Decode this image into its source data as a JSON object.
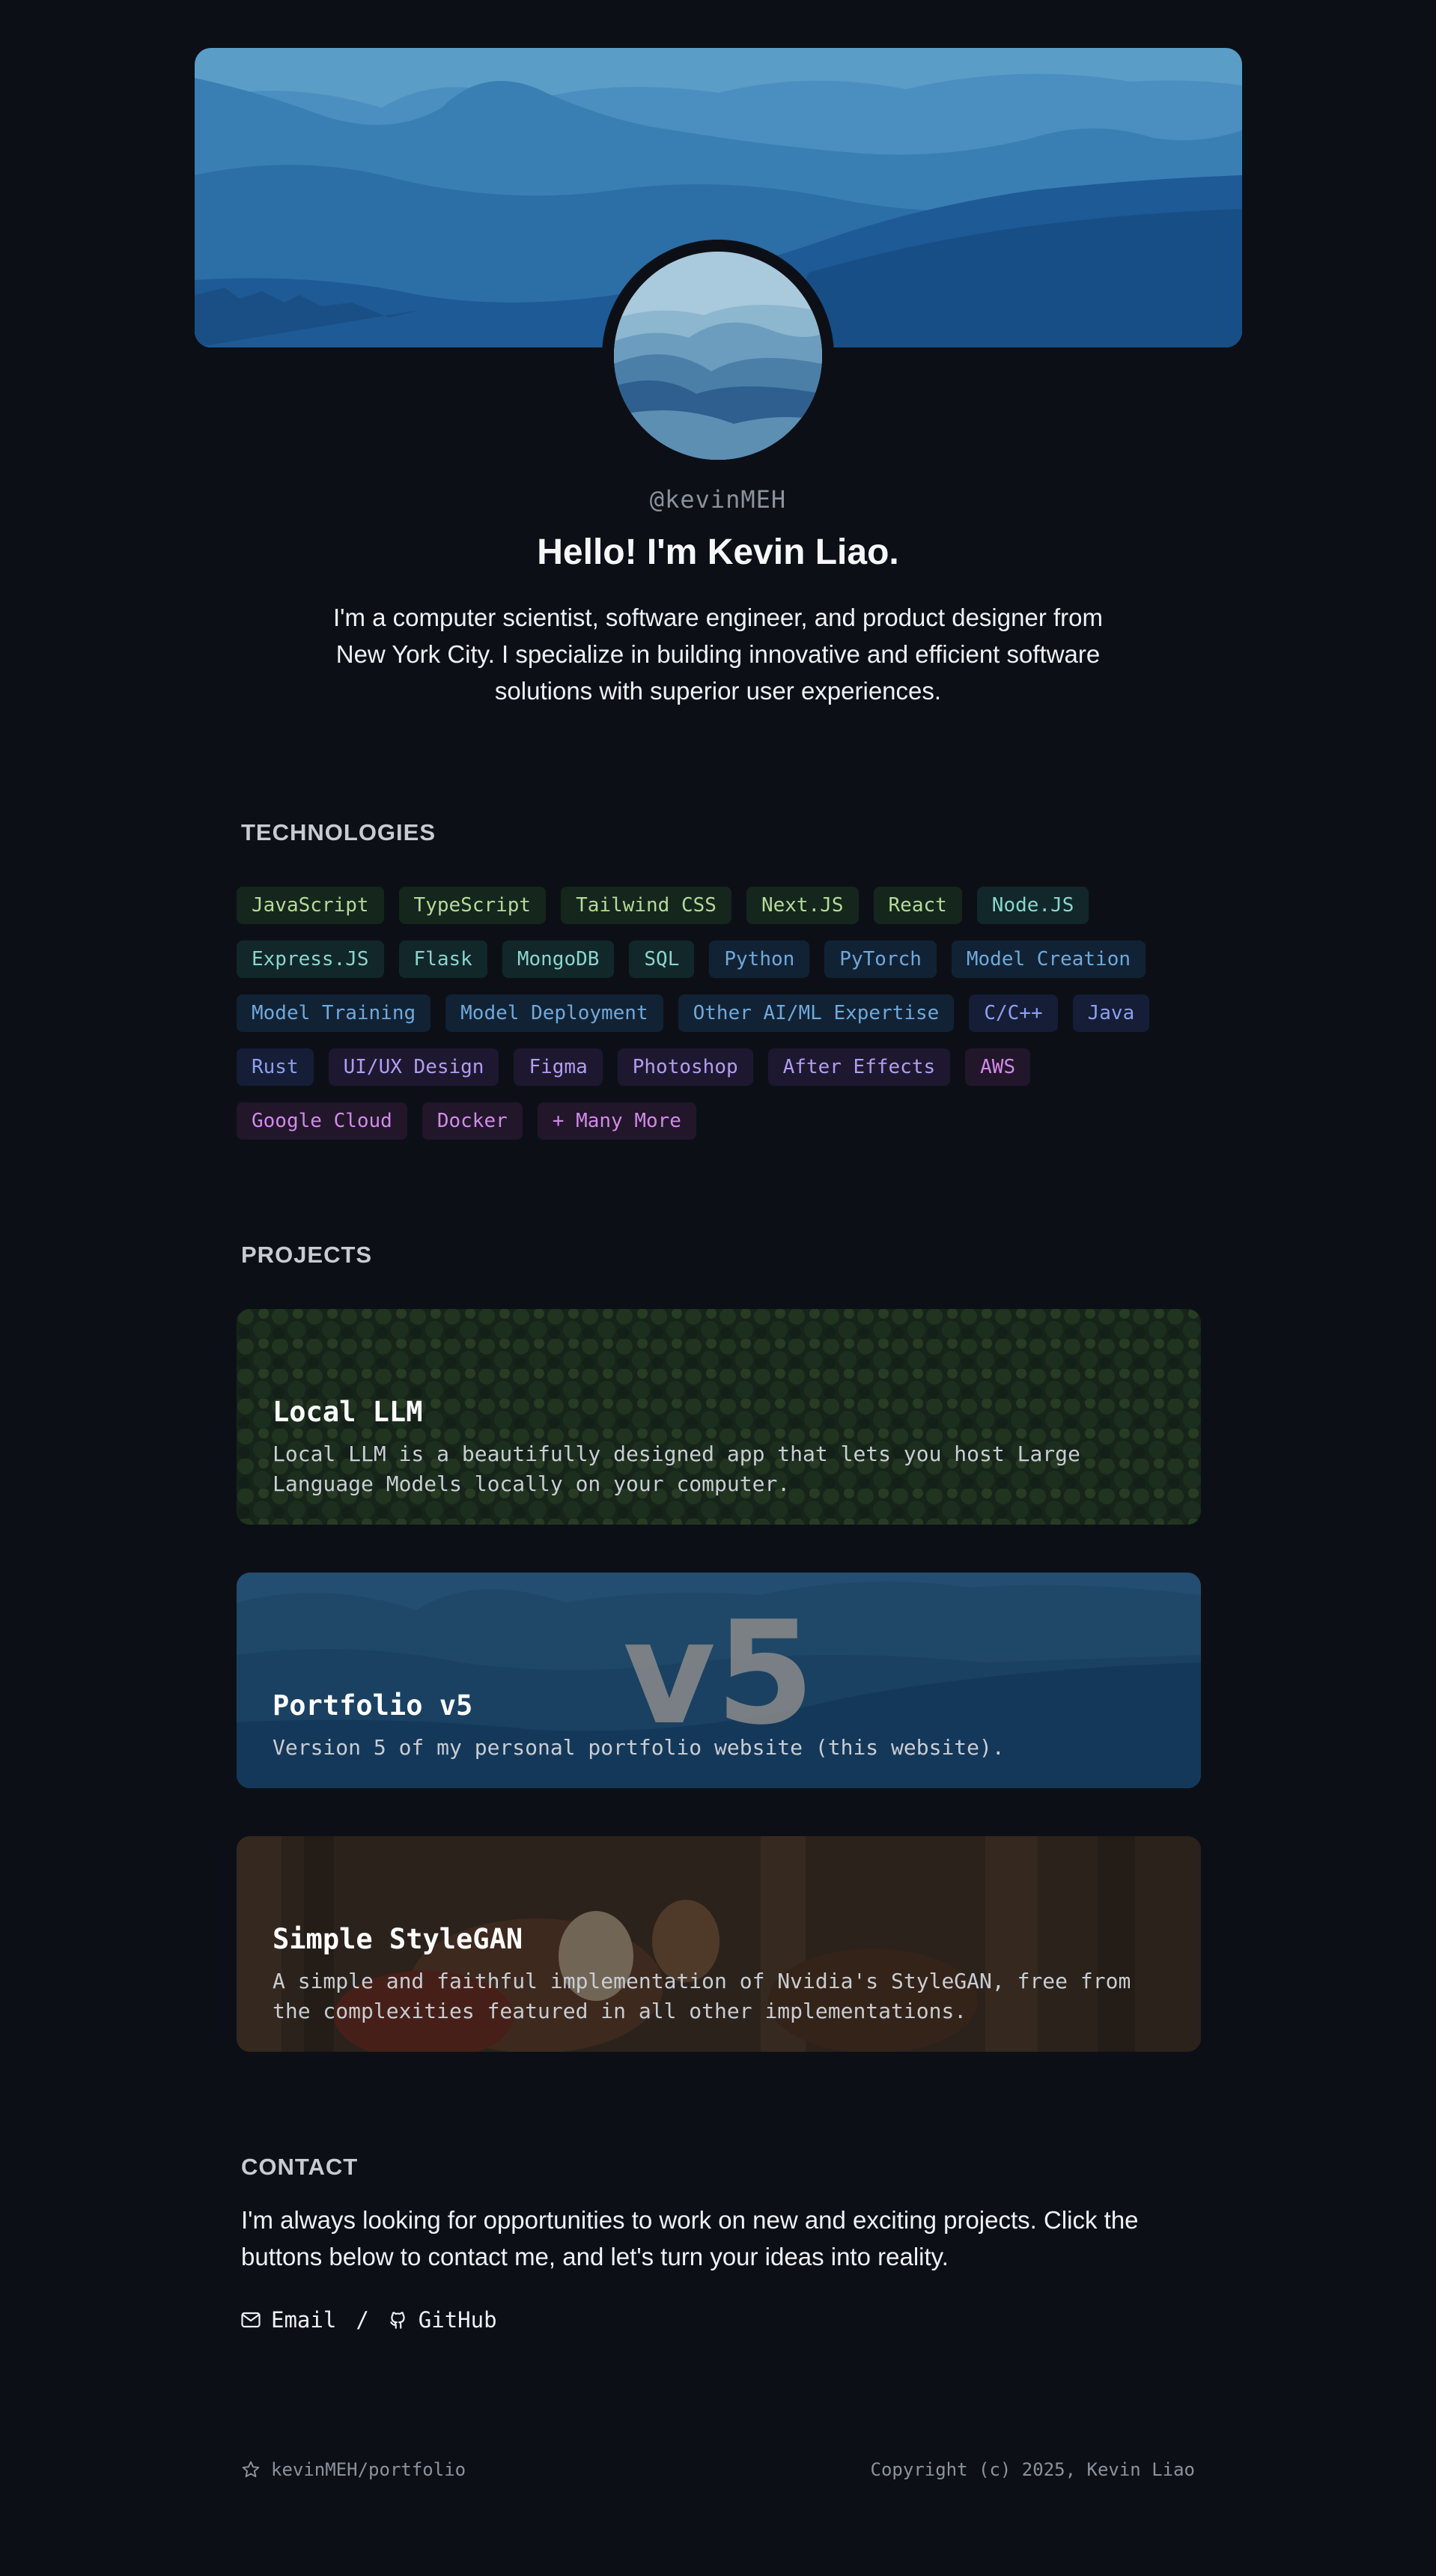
{
  "profile": {
    "handle": "@kevinMEH",
    "greeting": "Hello! I'm Kevin Liao.",
    "bio": "I'm a computer scientist, software engineer, and product designer from New York City. I specialize in building innovative and efficient software solutions with superior user experiences."
  },
  "technologies": {
    "title": "TECHNOLOGIES",
    "tags": [
      {
        "label": "JavaScript",
        "tone": "green"
      },
      {
        "label": "TypeScript",
        "tone": "green"
      },
      {
        "label": "Tailwind CSS",
        "tone": "green"
      },
      {
        "label": "Next.JS",
        "tone": "green"
      },
      {
        "label": "React",
        "tone": "green"
      },
      {
        "label": "Node.JS",
        "tone": "teal"
      },
      {
        "label": "Express.JS",
        "tone": "teal"
      },
      {
        "label": "Flask",
        "tone": "teal"
      },
      {
        "label": "MongoDB",
        "tone": "teal"
      },
      {
        "label": "SQL",
        "tone": "teal"
      },
      {
        "label": "Python",
        "tone": "blue"
      },
      {
        "label": "PyTorch",
        "tone": "blue"
      },
      {
        "label": "Model Creation",
        "tone": "blue"
      },
      {
        "label": "Model Training",
        "tone": "blue"
      },
      {
        "label": "Model Deployment",
        "tone": "blue"
      },
      {
        "label": "Other AI/ML Expertise",
        "tone": "blue"
      },
      {
        "label": "C/C++",
        "tone": "indigo"
      },
      {
        "label": "Java",
        "tone": "indigo"
      },
      {
        "label": "Rust",
        "tone": "indigo"
      },
      {
        "label": "UI/UX Design",
        "tone": "purple"
      },
      {
        "label": "Figma",
        "tone": "purple"
      },
      {
        "label": "Photoshop",
        "tone": "purple"
      },
      {
        "label": "After Effects",
        "tone": "purple"
      },
      {
        "label": "AWS",
        "tone": "pink"
      },
      {
        "label": "Google Cloud",
        "tone": "pink"
      },
      {
        "label": "Docker",
        "tone": "pink"
      },
      {
        "label": "+ Many More",
        "tone": "pink"
      }
    ]
  },
  "projects": {
    "title": "PROJECTS",
    "items": [
      {
        "title": "Local LLM",
        "description": "Local LLM is a beautifully designed app that lets you host Large Language Models locally on your computer."
      },
      {
        "title": "Portfolio v5",
        "description": "Version 5 of my personal portfolio website (this website).",
        "overlay": "v5"
      },
      {
        "title": "Simple StyleGAN",
        "description": "A simple and faithful implementation of Nvidia's StyleGAN, free from the complexities featured in all other implementations."
      }
    ]
  },
  "contact": {
    "title": "CONTACT",
    "text": "I'm always looking for opportunities to work on new and exciting projects. Click the buttons below to contact me, and let's turn your ideas into reality.",
    "email_label": "Email",
    "separator": "/",
    "github_label": "GitHub"
  },
  "footer": {
    "repo": "kevinMEH/portfolio",
    "copyright": "Copyright (c) 2025, Kevin Liao"
  }
}
